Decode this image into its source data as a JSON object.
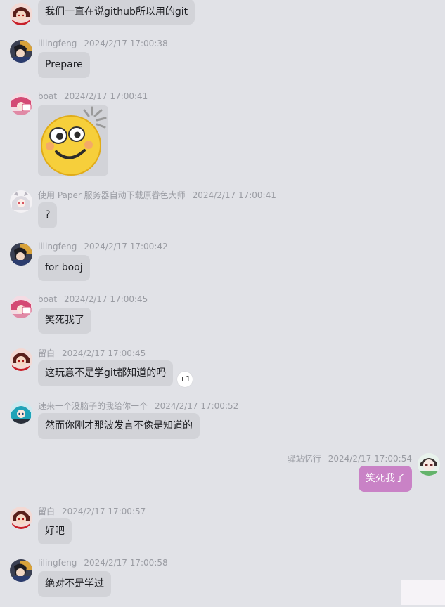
{
  "colors": {
    "background": "#e1e2e7",
    "bubble_other": "#d2d3d8",
    "bubble_self": "#c982c6",
    "meta_text": "#9a9ca3"
  },
  "messages": [
    {
      "sender": "",
      "time": "",
      "text": "我们一直在说github所以用的git",
      "avatar_icon": "red-hair-avatar-icon"
    },
    {
      "sender": "lilingfeng",
      "time": "2024/2/17 17:00:38",
      "text": "Prepare",
      "avatar_icon": "dark-hair-avatar-icon"
    },
    {
      "sender": "boat",
      "time": "2024/2/17 17:00:41",
      "text": "",
      "image": "smiling-emoji-sticker",
      "avatar_icon": "pink-anime-avatar-icon"
    },
    {
      "sender": "使用 Paper 服务器自动下载原眷色大师",
      "time": "2024/2/17 17:00:41",
      "text": "?",
      "avatar_icon": "white-hair-avatar-icon"
    },
    {
      "sender": "lilingfeng",
      "time": "2024/2/17 17:00:42",
      "text": "for booj",
      "avatar_icon": "dark-hair-avatar-icon"
    },
    {
      "sender": "boat",
      "time": "2024/2/17 17:00:45",
      "text": "笑死我了",
      "avatar_icon": "pink-anime-avatar-icon"
    },
    {
      "sender": "留白",
      "time": "2024/2/17 17:00:45",
      "text": "这玩意不是学git都知道的吗",
      "reaction": "+1",
      "avatar_icon": "red-hair-avatar-icon"
    },
    {
      "sender": "速来一个没脑子的我给你一个",
      "time": "2024/2/17 17:00:52",
      "text": "然而你刚才那波发言不像是知道的",
      "avatar_icon": "teal-hair-avatar-icon"
    },
    {
      "sender": "驿站忆行",
      "time": "2024/2/17 17:00:54",
      "text": "笑死我了",
      "self": true,
      "avatar_icon": "chibi-avatar-icon"
    },
    {
      "sender": "留白",
      "time": "2024/2/17 17:00:57",
      "text": "好吧",
      "avatar_icon": "red-hair-avatar-icon"
    },
    {
      "sender": "lilingfeng",
      "time": "2024/2/17 17:00:58",
      "text": "绝对不是学过",
      "avatar_icon": "dark-hair-avatar-icon"
    }
  ]
}
